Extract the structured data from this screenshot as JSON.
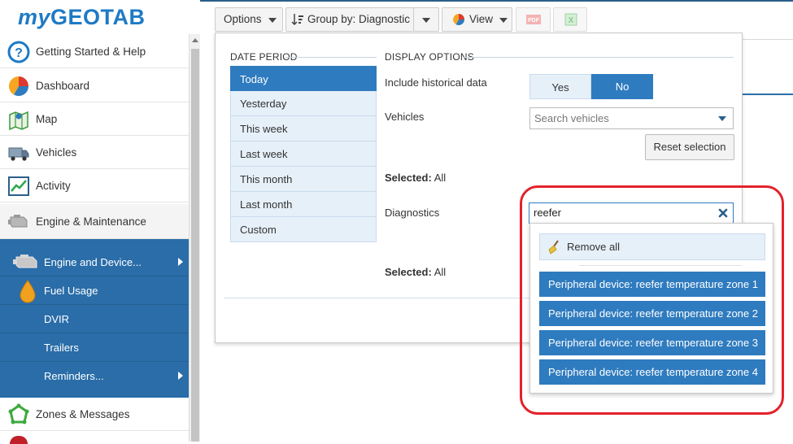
{
  "brand": {
    "my": "my",
    "geotab": "GEOTAB"
  },
  "sidebar": {
    "items": [
      {
        "label": "Getting Started & Help",
        "icon": "help-icon"
      },
      {
        "label": "Dashboard",
        "icon": "dashboard-icon"
      },
      {
        "label": "Map",
        "icon": "map-icon"
      },
      {
        "label": "Vehicles",
        "icon": "truck-icon"
      },
      {
        "label": "Activity",
        "icon": "activity-icon"
      },
      {
        "label": "Engine & Maintenance",
        "icon": "engine-icon"
      }
    ],
    "submenu": [
      {
        "label": "Engine and Device...",
        "has_arrow": true
      },
      {
        "label": "Fuel Usage",
        "has_arrow": false
      },
      {
        "label": "DVIR",
        "has_arrow": false
      },
      {
        "label": "Trailers",
        "has_arrow": false
      },
      {
        "label": "Reminders...",
        "has_arrow": true
      }
    ],
    "after": [
      {
        "label": "Zones & Messages",
        "icon": "zone-icon"
      }
    ]
  },
  "toolbar": {
    "options": "Options",
    "group_by": "Group by: Diagnostic",
    "view": "View",
    "pdf_icon": "pdf-icon",
    "excel_icon": "excel-icon"
  },
  "panel": {
    "date_period_title": "DATE PERIOD",
    "display_options_title": "DISPLAY OPTIONS",
    "periods": [
      "Today",
      "Yesterday",
      "This week",
      "Last week",
      "This month",
      "Last month",
      "Custom"
    ],
    "selected_period": "Today",
    "include_historical_label": "Include historical data",
    "yes": "Yes",
    "no": "No",
    "historical_selected": "No",
    "vehicles_label": "Vehicles",
    "vehicles_placeholder": "Search vehicles",
    "reset_selection": "Reset selection",
    "selected_label": "Selected:",
    "vehicles_selected_value": "All",
    "diagnostics_label": "Diagnostics",
    "diagnostics_value": "reefer",
    "diagnostics_selected_value": "All"
  },
  "dropdown": {
    "remove_all": "Remove all",
    "results": [
      "Peripheral device: reefer temperature zone 1",
      "Peripheral device: reefer temperature zone 2",
      "Peripheral device: reefer temperature zone 3",
      "Peripheral device: reefer temperature zone 4"
    ]
  },
  "colors": {
    "brand_blue": "#1e7ac5",
    "selected_blue": "#2f7bbf",
    "sidebar_sub_bg": "#2a6da8",
    "highlight_red": "#e3222b"
  }
}
